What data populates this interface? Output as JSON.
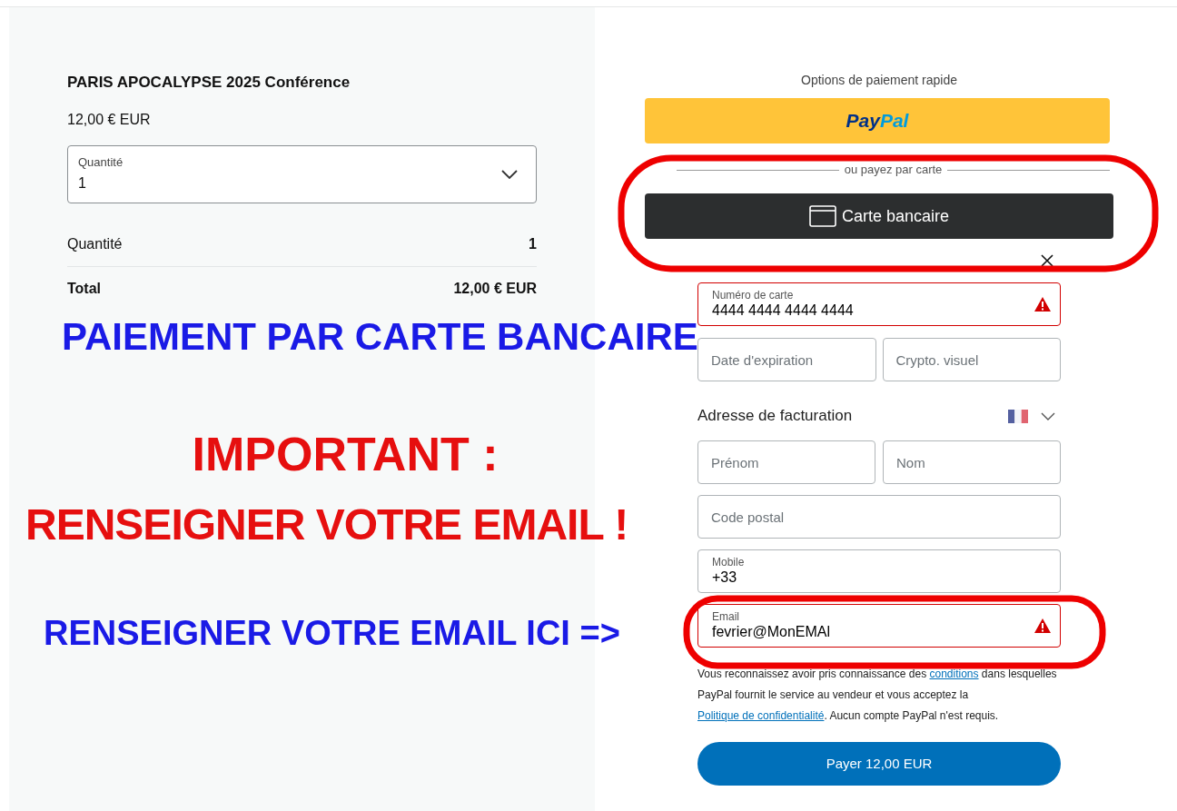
{
  "product": {
    "title": "PARIS APOCALYPSE 2025 Conférence",
    "price": "12,00 € EUR",
    "quantity_select": {
      "label": "Quantité",
      "value": "1"
    }
  },
  "summary": [
    {
      "label": "Quantité",
      "value": "1",
      "kind": "row"
    },
    {
      "label": "Total",
      "value": "12,00 € EUR",
      "kind": "total"
    }
  ],
  "quick_pay": {
    "title": "Options de paiement rapide",
    "paypal_logo": [
      "Pay",
      "Pal"
    ]
  },
  "divider": "ou payez par carte",
  "card_button": "Carte bancaire",
  "card_fields": {
    "number": {
      "label": "Numéro de carte",
      "value": "4444 4444 4444 4444",
      "error": true
    },
    "expiry": {
      "placeholder": "Date d'expiration"
    },
    "cvv": {
      "placeholder": "Crypto. visuel"
    }
  },
  "billing": {
    "title": "Adresse de facturation",
    "first_name": {
      "placeholder": "Prénom"
    },
    "last_name": {
      "placeholder": "Nom"
    },
    "postal_code": {
      "placeholder": "Code postal"
    },
    "mobile": {
      "label": "Mobile",
      "value": "+33",
      "error": false
    },
    "email": {
      "label": "Email",
      "value": "fevrier@MonEMAl",
      "error": true
    }
  },
  "legal": [
    {
      "kind": "text",
      "text": "Vous reconnaissez avoir pris connaissance des "
    },
    {
      "kind": "link",
      "text": "conditions"
    },
    {
      "kind": "text",
      "text": " dans lesquelles PayPal fournit le service au vendeur et vous acceptez la "
    },
    {
      "kind": "link",
      "text": "Politique de confidentialité"
    },
    {
      "kind": "text",
      "text": ". Aucun compte PayPal n'est requis."
    }
  ],
  "pay_button": "Payer 12,00 EUR",
  "annotations": [
    {
      "text": "PAIEMENT PAR CARTE BANCAIRE",
      "color": "#1a1ae6"
    },
    {
      "text": "IMPORTANT :",
      "color": "#e60f0f"
    },
    {
      "text": "RENSEIGNER VOTRE EMAIL !",
      "color": "#e60f0f"
    },
    {
      "text": "RENSEIGNER VOTRE EMAIL ICI =>",
      "color": "#1a1ae6"
    }
  ]
}
